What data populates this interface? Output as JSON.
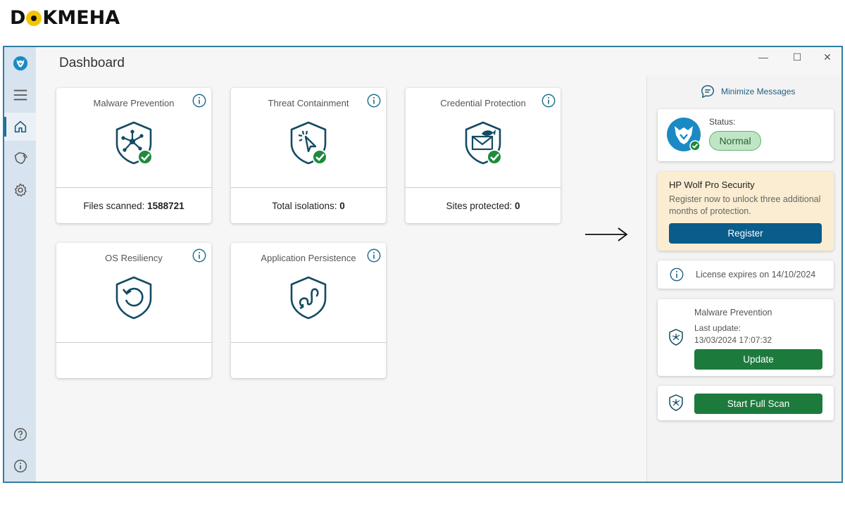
{
  "brand": {
    "logo_text": "DOKMEHA",
    "accent": "#f5c400"
  },
  "window": {
    "title": "Dashboard",
    "controls": {
      "minimize": "—",
      "maximize": "☐",
      "close": "✕"
    }
  },
  "sidebar": {
    "items": [
      {
        "name": "logo",
        "icon": "wolf-logo-icon"
      },
      {
        "name": "menu",
        "icon": "hamburger-menu-icon"
      },
      {
        "name": "home",
        "icon": "home-icon",
        "active": true
      },
      {
        "name": "alerts",
        "icon": "shield-alert-icon"
      },
      {
        "name": "settings",
        "icon": "gear-icon"
      },
      {
        "name": "help",
        "icon": "help-icon"
      },
      {
        "name": "about",
        "icon": "info-icon"
      }
    ]
  },
  "cards": [
    {
      "title": "Malware Prevention",
      "footer_label": "Files scanned:",
      "footer_value": "1588721",
      "icon": "shield-network-icon",
      "status": "check"
    },
    {
      "title": "Threat Containment",
      "footer_label": "Total isolations:",
      "footer_value": "0",
      "icon": "shield-cursor-icon",
      "status": "check"
    },
    {
      "title": "Credential Protection",
      "footer_label": "Sites protected:",
      "footer_value": "0",
      "icon": "shield-fish-icon",
      "status": "check"
    },
    {
      "title": "OS Resiliency",
      "footer_label": "",
      "footer_value": "",
      "icon": "shield-restore-icon"
    },
    {
      "title": "Application Persistence",
      "footer_label": "",
      "footer_value": "",
      "icon": "shield-persistence-icon"
    }
  ],
  "panel": {
    "minimize_messages": "Minimize Messages",
    "status": {
      "label": "Status:",
      "value": "Normal"
    },
    "promo": {
      "title": "HP Wolf Pro Security",
      "text": "Register now to unlock three additional months of protection.",
      "button": "Register"
    },
    "license": {
      "text": "License expires on 14/10/2024"
    },
    "malware_update": {
      "title": "Malware Prevention",
      "last_update_label": "Last update:",
      "last_update_value": "13/03/2024 17:07:32",
      "button": "Update"
    },
    "scan": {
      "button": "Start Full Scan"
    }
  },
  "colors": {
    "primary": "#0a5c8a",
    "green": "#1c7a3d",
    "check": "#1e8a3c",
    "shield": "#134b63"
  }
}
